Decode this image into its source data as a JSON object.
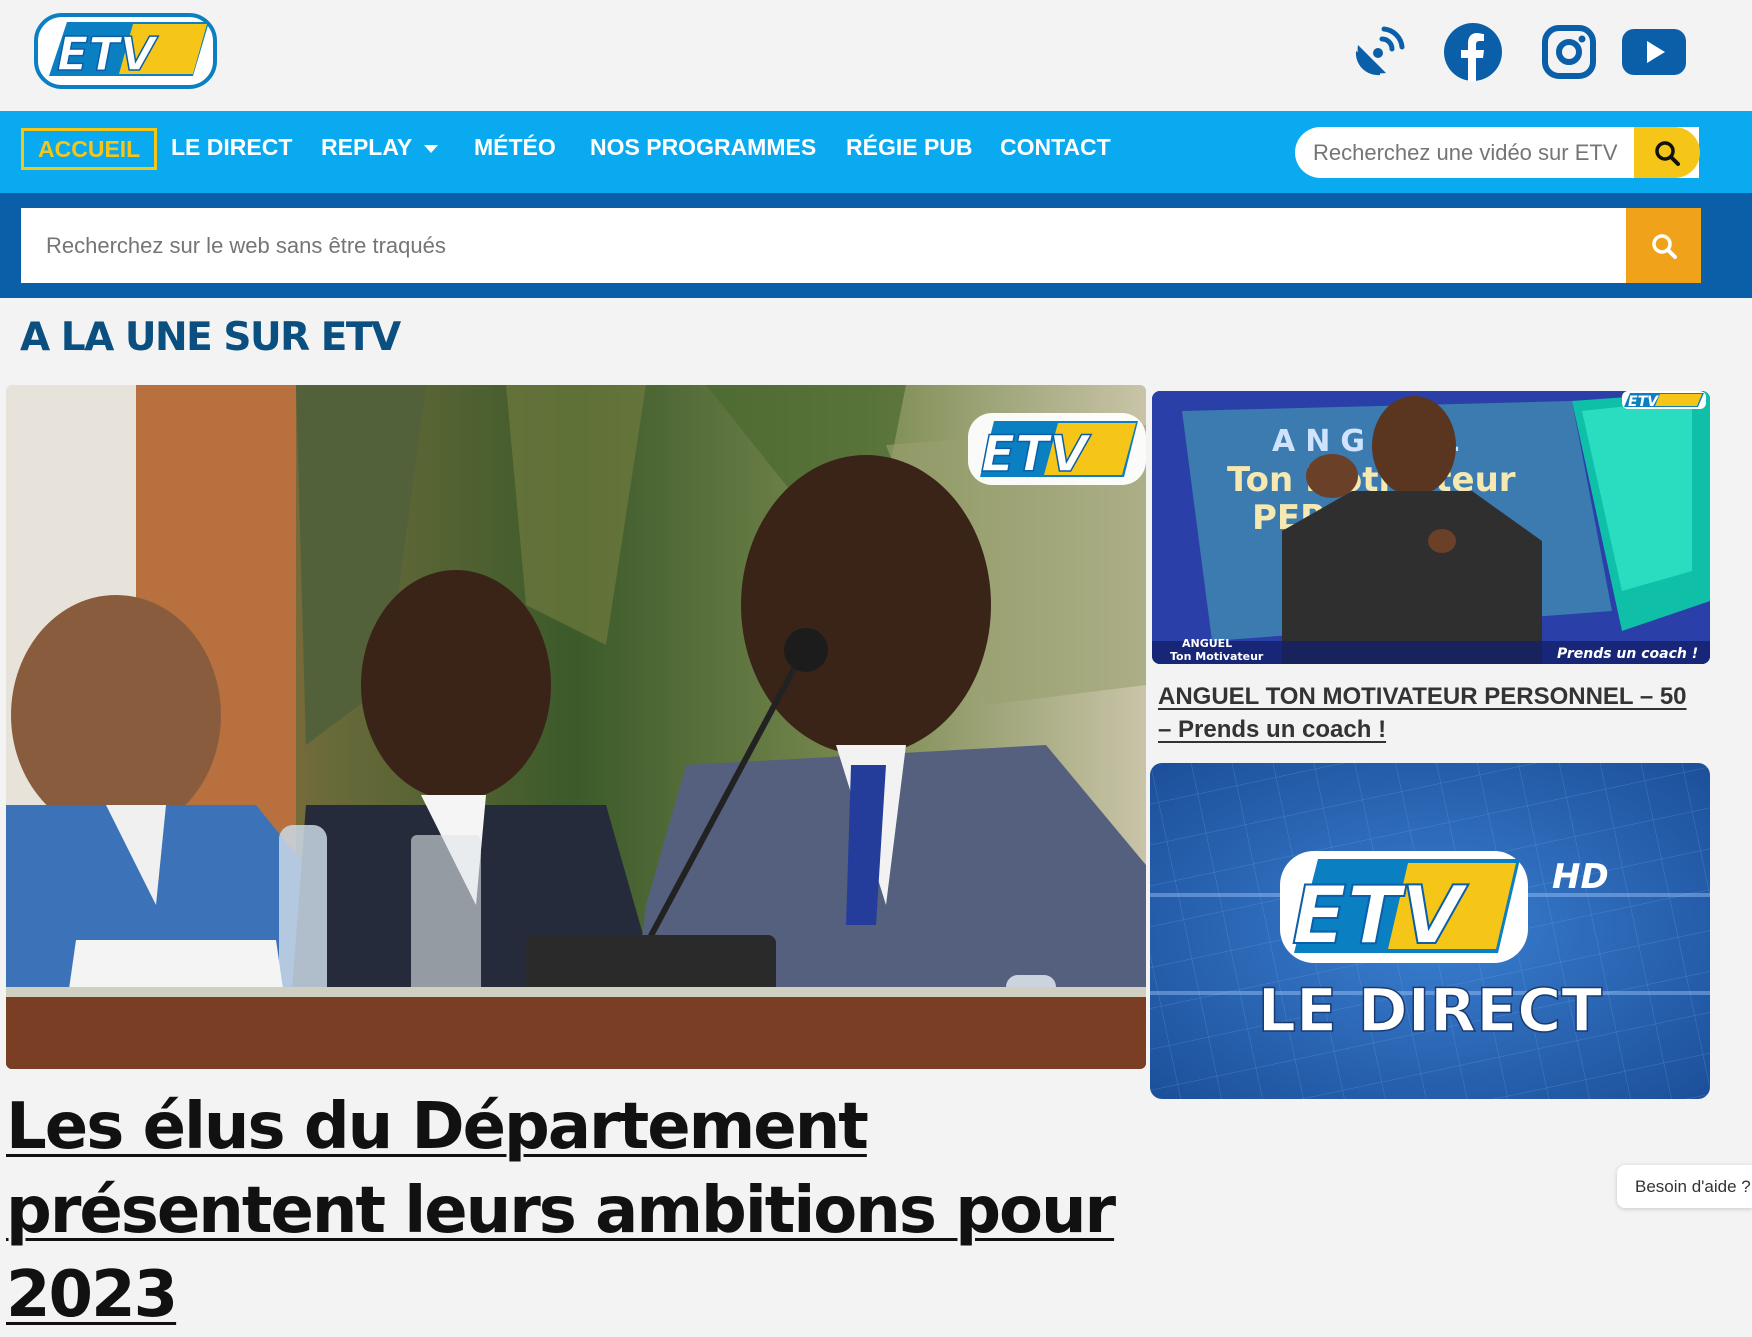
{
  "colors": {
    "nav": "#0aaaf0",
    "band": "#0a5fa8",
    "accent_yellow": "#f5c518",
    "search_orange": "#f0a21a",
    "title_blue": "#0a4f80"
  },
  "header": {
    "logo_text": "ETV",
    "social": [
      {
        "name": "satellite-dish-icon"
      },
      {
        "name": "facebook-icon"
      },
      {
        "name": "instagram-icon"
      },
      {
        "name": "youtube-icon"
      }
    ]
  },
  "nav": {
    "items": [
      "ACCUEIL",
      "LE DIRECT",
      "REPLAY",
      "MÉTÉO",
      "NOS PROGRAMMES",
      "RÉGIE PUB",
      "CONTACT"
    ],
    "active": "ACCUEIL",
    "video_search_placeholder": "Recherchez une vidéo sur ETV"
  },
  "web_search": {
    "placeholder": "Recherchez sur le web sans être traqués"
  },
  "section": {
    "title": "A LA UNE SUR ETV"
  },
  "main_article": {
    "headline": "Les élus du Département présentent leurs ambitions pour 2023",
    "image_logo": "ETV"
  },
  "side_article": {
    "headline": "ANGUEL TON MOTIVATEUR PERSONNEL – 50 – Prends un coach !",
    "thumb_lines": [
      "ANGUEL",
      "Ton Motivateur",
      "PERSONNEL"
    ],
    "thumb_caption": "Prends un coach !",
    "thumb_logo": "ETV",
    "small_title_lines": [
      "ANGUEL",
      "Ton Motivateur"
    ]
  },
  "direct_banner": {
    "logo": "ETV",
    "hd": "HD",
    "label": "LE DIRECT"
  },
  "help": {
    "label": "Besoin d'aide ?"
  }
}
